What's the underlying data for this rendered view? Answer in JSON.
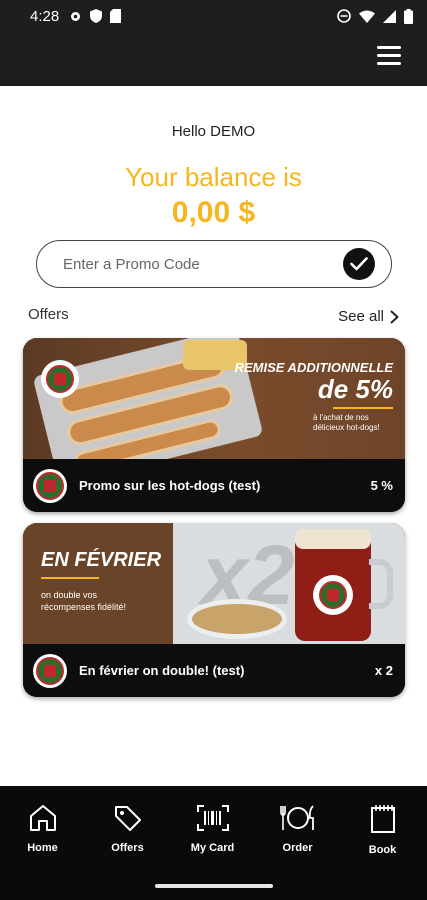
{
  "status_bar": {
    "time": "4:28"
  },
  "greeting": "Hello DEMO",
  "balance": {
    "label": "Your balance is",
    "value": "0,00 $"
  },
  "promo": {
    "placeholder": "Enter a Promo Code"
  },
  "offers": {
    "title": "Offers",
    "see_all": "See all",
    "items": [
      {
        "title": "Promo sur les hot-dogs (test)",
        "badge": "5 %",
        "banner": {
          "line1": "REMISE ADDITIONNELLE",
          "line2": "de 5%",
          "line3": "à l'achat de nos délicieux hot-dogs!"
        }
      },
      {
        "title": "En février on double! (test)",
        "badge": "x 2",
        "banner": {
          "line1": "EN FÉVRIER",
          "line2": "on double vos récompenses fidélité!",
          "mark": "x2"
        }
      }
    ]
  },
  "nav": [
    {
      "label": "Home",
      "icon": "home-icon"
    },
    {
      "label": "Offers",
      "icon": "tag-icon"
    },
    {
      "label": "My Card",
      "icon": "barcode-icon"
    },
    {
      "label": "Order",
      "icon": "plate-cutlery-icon"
    },
    {
      "label": "Book",
      "icon": "notebook-icon"
    }
  ],
  "colors": {
    "accent": "#f7b51e",
    "dark": "#1e1e1e",
    "nav_bg": "#0a0a0a"
  }
}
